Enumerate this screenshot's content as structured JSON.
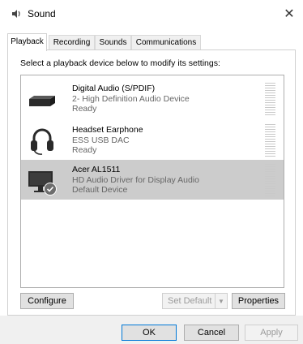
{
  "window": {
    "title": "Sound",
    "icon": "speaker-icon",
    "close_glyph": "✕"
  },
  "tabs": [
    {
      "label": "Playback",
      "active": true
    },
    {
      "label": "Recording",
      "active": false
    },
    {
      "label": "Sounds",
      "active": false
    },
    {
      "label": "Communications",
      "active": false
    }
  ],
  "instruction": "Select a playback device below to modify its settings:",
  "devices": [
    {
      "name": "Digital Audio (S/PDIF)",
      "description": "2- High Definition Audio Device",
      "status": "Ready",
      "icon": "spdif-device-icon",
      "selected": false
    },
    {
      "name": "Headset Earphone",
      "description": "ESS USB DAC",
      "status": "Ready",
      "icon": "headset-icon",
      "selected": false
    },
    {
      "name": "Acer AL1511",
      "description": "HD Audio Driver for Display Audio",
      "status": "Default Device",
      "icon": "monitor-icon",
      "selected": true,
      "default": true
    }
  ],
  "buttons": {
    "configure": "Configure",
    "set_default": "Set Default",
    "properties": "Properties",
    "ok": "OK",
    "cancel": "Cancel",
    "apply": "Apply"
  },
  "colors": {
    "selected_row": "#cccccc",
    "default_check": "#6d6d6d"
  }
}
